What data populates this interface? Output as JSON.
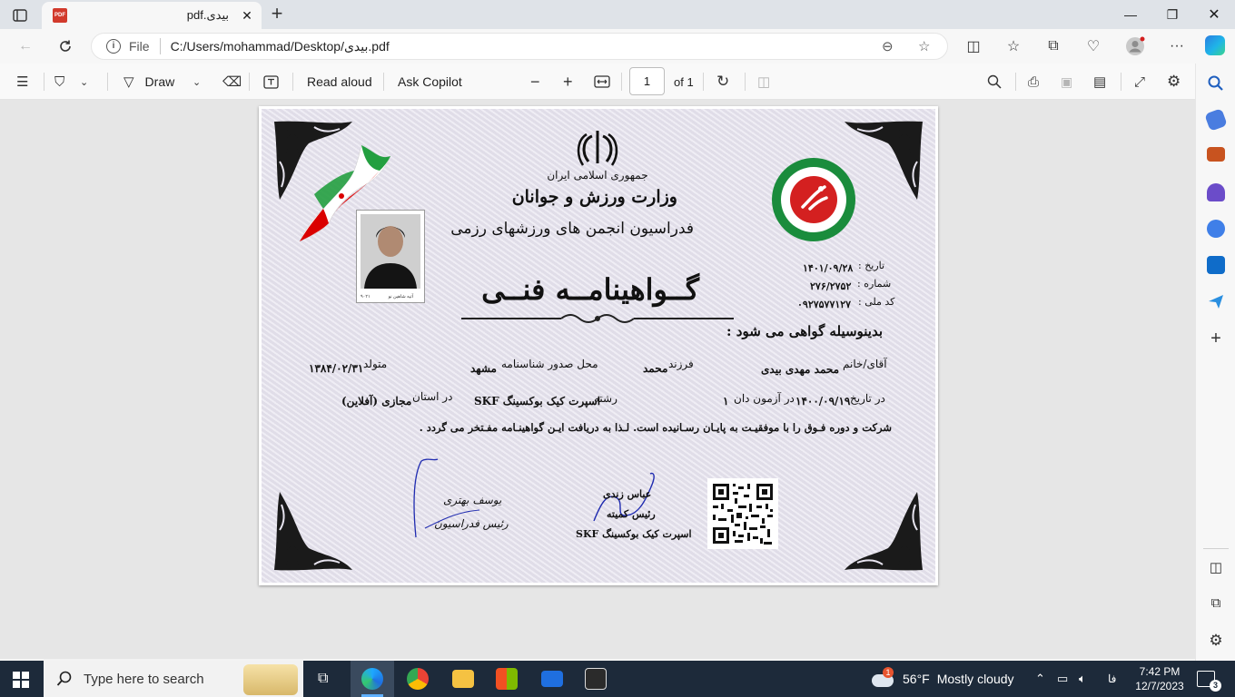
{
  "tab": {
    "title": "pdf.بیدی",
    "favicon": "pdf-icon",
    "close_glyph": "✕"
  },
  "window": {
    "minimize": "—",
    "maximize": "❐",
    "close": "✕"
  },
  "address": {
    "site_label": "File",
    "url": "C:/Users/mohammad/Desktop/بیدی.pdf"
  },
  "pdf_toolbar": {
    "draw_label": "Draw",
    "read_aloud_label": "Read aloud",
    "ask_copilot_label": "Ask Copilot",
    "page_current": "1",
    "page_total": "of 1"
  },
  "certificate": {
    "republic": "جمهوری اسلامی ایران",
    "ministry": "وزارت ورزش و جوانان",
    "federation": "فدراسیون انجمن های ورزشهای رزمی",
    "title": "گــواهینامــه فنــی",
    "date_label": "تاریخ :",
    "date_value": "۱۴۰۱/۰۹/۲۸",
    "number_label": "شماره :",
    "number_value": "۲۷۶/۲۷۵۲",
    "national_code_label": "کد ملی :",
    "national_code_value": "۰۹۲۷۵۷۷۱۲۷",
    "intro": "بدینوسیله گواهی می شود :",
    "name_label": "آقای/خانم",
    "name_value": "محمد مهدی بیدی",
    "father_label": "فرزند",
    "father_value": "محمد",
    "issue_place_label": "محل صدور شناسنامه",
    "issue_place_value": "مشهد",
    "born_label": "متولد",
    "born_value": "۱۳۸۴/۰۲/۳۱",
    "exam_date_label": "در تاریخ",
    "exam_date_value": "۱۴۰۰/۰۹/۱۹",
    "exam_label": "در آزمون دان",
    "exam_value": "۱",
    "field_label": "رشته",
    "field_value": "اسپرت کیک بوکسینگ SKF",
    "province_label": "در استان",
    "province_value": "مجازی (آفلاین)",
    "closing": "شرکت و دوره  فـوق را با موفقیـت به پایـان رسـانیده است. لـذا به دریافت ایـن گواهینـامه  مفـتخر می گردد .",
    "signer1_name": "عباس زندی",
    "signer1_role": "رئیس کمیته",
    "signer1_org": "اسپرت کیک بوکسینگ SKF",
    "signer2_name": "یوسف بهتری",
    "signer2_role": "رئیس فدراسیون",
    "photo_caption": "آتیه شاهین نو",
    "photo_code": "۹۰۲۱"
  },
  "taskbar": {
    "search_placeholder": "Type here to search",
    "weather_temp": "56°F",
    "weather_text": "Mostly cloudy",
    "weather_badge": "1",
    "lang": "فا",
    "time": "7:42 PM",
    "date": "12/7/2023",
    "notification_count": "3"
  },
  "colors": {
    "taskbar_bg": "#1d2a3a",
    "tab_strip_bg": "#dfe3e8",
    "certificate_bg": "#e7e4ef",
    "seal_green": "#1a8c3c",
    "seal_red": "#d42020",
    "flag_green": "#239f40",
    "flag_red": "#da0000"
  }
}
